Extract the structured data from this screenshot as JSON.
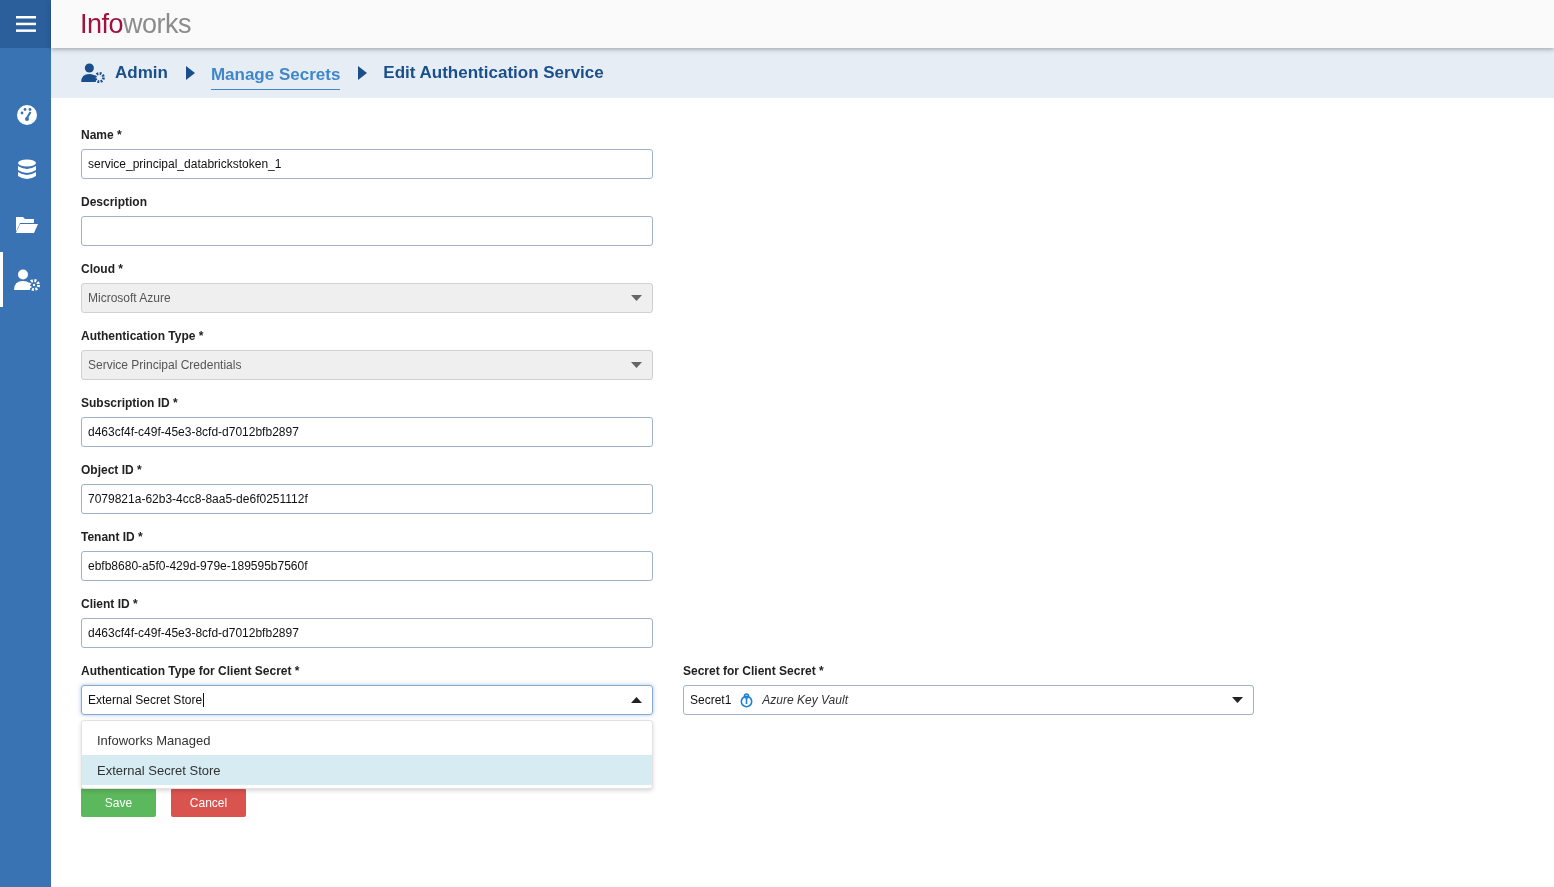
{
  "logo": {
    "part_1": "Info",
    "part_2": "works"
  },
  "sidebar": {
    "items": [
      {
        "selected": false
      },
      {
        "selected": false
      },
      {
        "selected": false
      },
      {
        "selected": true
      }
    ]
  },
  "breadcrumb": [
    {
      "label": "Admin",
      "kind": "root"
    },
    {
      "label": "Manage Secrets",
      "kind": "link"
    },
    {
      "label": "Edit Authentication Service",
      "kind": "current"
    }
  ],
  "fields": [
    {
      "label": "Name *",
      "kind": "text",
      "value": "service_principal_databrickstoken_1"
    },
    {
      "label": "Description",
      "kind": "text"
    },
    {
      "label": "Cloud *",
      "kind": "select",
      "disabled": true,
      "value": "Microsoft Azure"
    },
    {
      "label": "Authentication Type *",
      "kind": "select",
      "disabled": true,
      "value": "Service Principal Credentials"
    },
    {
      "label": "Subscription ID *",
      "kind": "text",
      "value": "d463cf4f-c49f-45e3-8cfd-d7012bfb2897"
    },
    {
      "label": "Object ID *",
      "kind": "text",
      "value": "7079821a-62b3-4cc8-8aa5-de6f0251112f"
    },
    {
      "label": "Tenant ID *",
      "kind": "text",
      "value": "ebfb8680-a5f0-429d-979e-189595b7560f"
    },
    {
      "label": "Client ID *",
      "kind": "text",
      "value": "d463cf4f-c49f-45e3-8cfd-d7012bfb2897"
    }
  ],
  "client_secret_type": {
    "label": "Authentication Type for Client Secret *",
    "value": "External Secret Store",
    "expanded": true,
    "options": [
      {
        "label": "Infoworks Managed",
        "selected": false
      },
      {
        "label": "External Secret Store",
        "selected": true
      }
    ]
  },
  "client_secret": {
    "label": "Secret for Client Secret *",
    "value": "Secret1",
    "store": "Azure Key Vault"
  },
  "buttons": [
    {
      "label": "Save",
      "kind": "primary"
    },
    {
      "label": "Cancel",
      "kind": "danger"
    }
  ]
}
